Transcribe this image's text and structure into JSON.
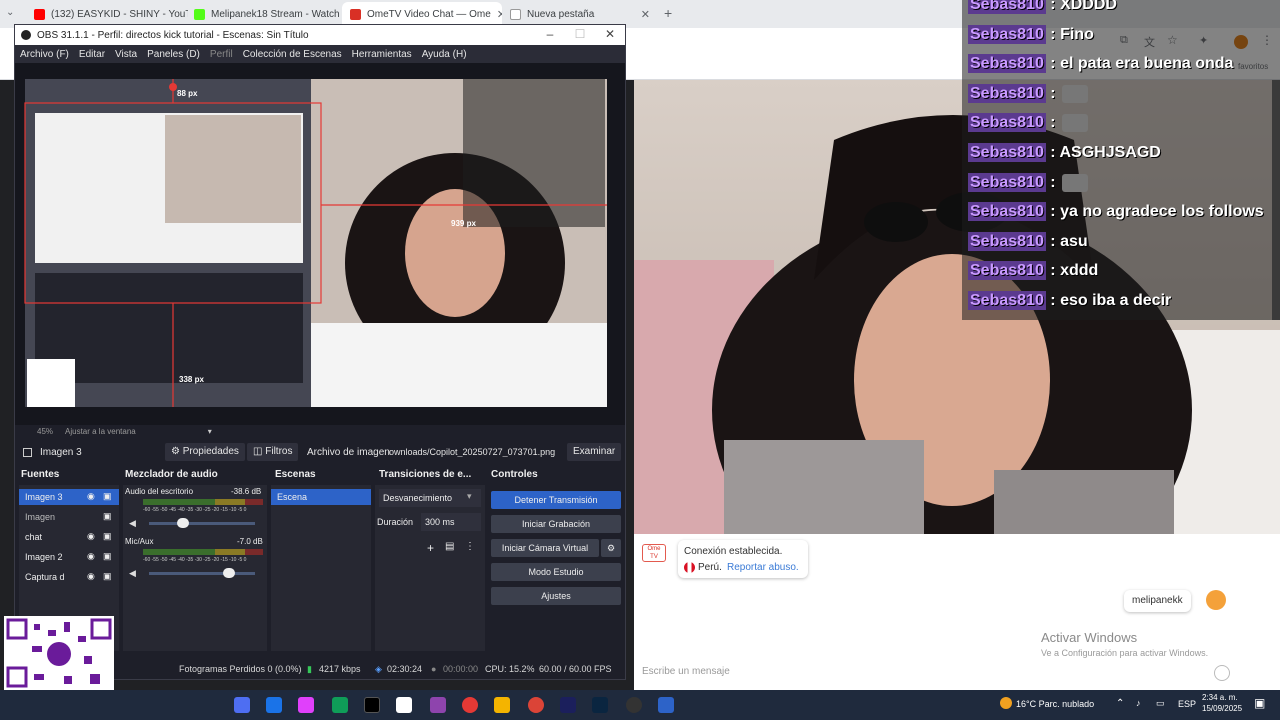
{
  "browser": {
    "tabs": [
      {
        "title": "(132) EASYKID - SHINY - YouTub",
        "color": "#ff0000"
      },
      {
        "title": "Melipanek18 Stream - Watch Li",
        "color": "#53fc18"
      },
      {
        "title": "OmeTV Video Chat — Ome",
        "color": "#d93025"
      },
      {
        "title": "Nueva pestaña",
        "color": "#5f6368"
      }
    ],
    "bookmarks_label": "favoritos"
  },
  "obs": {
    "title": "OBS 31.1.1 - Perfil: directos kick tutorial - Escenas: Sin Título",
    "menu": [
      "Archivo (F)",
      "Editar",
      "Vista",
      "Paneles (D)",
      "Perfil",
      "Colección de Escenas",
      "Herramientas",
      "Ayuda (H)"
    ],
    "preview": {
      "measure_top": "88 px",
      "measure_right": "939 px",
      "measure_bottom": "338 px"
    },
    "zoom": "45%",
    "zoom_mode": "Ajustar a la ventana",
    "source_bar": {
      "name": "Imagen 3",
      "props": "Propiedades",
      "filters": "Filtros",
      "file_label": "Archivo de imagen",
      "file_path": "ownloads/Copilot_20250727_073701.png",
      "browse": "Examinar"
    },
    "docks": {
      "sources_title": "Fuentes",
      "mixer_title": "Mezclador de audio",
      "scenes_title": "Escenas",
      "transitions_title": "Transiciones de e...",
      "controls_title": "Controles"
    },
    "sources": [
      "Imagen 3",
      "Imagen",
      "chat",
      "Imagen 2",
      "Captura d"
    ],
    "mixer": [
      {
        "name": "Audio del escritorio",
        "db": "-38.6 dB"
      },
      {
        "name": "Mic/Aux",
        "db": "-7.0 dB"
      }
    ],
    "mixer_scale": "-60 -55 -50 -45 -40 -35 -30 -25 -20 -15 -10 -5 0",
    "scenes": [
      "Escena"
    ],
    "transition": {
      "type": "Desvanecimiento",
      "duration_label": "Duración",
      "duration": "300 ms"
    },
    "controls": [
      "Detener Transmisión",
      "Iniciar Grabación",
      "Iniciar Cámara Virtual",
      "Modo Estudio",
      "Ajustes"
    ],
    "status": {
      "dropped": "Fotogramas Perdidos 0 (0.0%)",
      "bitrate": "4217 kbps",
      "stream_time": "02:30:24",
      "rec_time": "00:00:00",
      "cpu": "CPU: 15.2%",
      "fps": "60.00 / 60.00 FPS"
    }
  },
  "chat": [
    {
      "user": "Sebas810",
      "msg": ": XDDDD",
      "emote": false
    },
    {
      "user": "Sebas810",
      "msg": ": Fino",
      "emote": false
    },
    {
      "user": "Sebas810",
      "msg": ": el pata era buena onda",
      "emote": false
    },
    {
      "user": "Sebas810",
      "msg": ":",
      "emote": true
    },
    {
      "user": "Sebas810",
      "msg": ":",
      "emote": true
    },
    {
      "user": "Sebas810",
      "msg": ": ASGHJSAGD",
      "emote": false
    },
    {
      "user": "Sebas810",
      "msg": ":",
      "emote": true
    },
    {
      "user": "Sebas810",
      "msg": ": ya no agradece los follows",
      "emote": false
    },
    {
      "user": "Sebas810",
      "msg": ": asu",
      "emote": false
    },
    {
      "user": "Sebas810",
      "msg": ": xddd",
      "emote": false
    },
    {
      "user": "Sebas810",
      "msg": ": eso iba a decir",
      "emote": false
    }
  ],
  "ome": {
    "connection": "Conexión establecida.",
    "country": "Perú.",
    "report": "Reportar abuso.",
    "partner": "melipanekk",
    "activate_title": "Activar Windows",
    "activate_sub": "Ve a Configuración para activar Windows.",
    "message_placeholder": "Escribe un mensaje"
  },
  "taskbar": {
    "weather": "16°C  Parc. nublado",
    "lang": "ESP",
    "time": "2:34 a. m.",
    "date": "15/09/2025"
  }
}
